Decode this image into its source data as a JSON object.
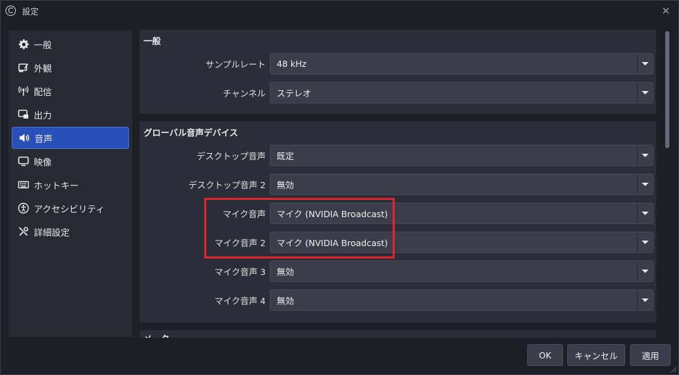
{
  "window": {
    "title": "設定"
  },
  "sidebar": {
    "items": [
      {
        "label": "一般",
        "icon": "gear-icon"
      },
      {
        "label": "外観",
        "icon": "paint-icon"
      },
      {
        "label": "配信",
        "icon": "antenna-icon"
      },
      {
        "label": "出力",
        "icon": "output-icon"
      },
      {
        "label": "音声",
        "icon": "speaker-icon",
        "active": true
      },
      {
        "label": "映像",
        "icon": "monitor-icon"
      },
      {
        "label": "ホットキー",
        "icon": "keyboard-icon"
      },
      {
        "label": "アクセシビリティ",
        "icon": "accessibility-icon"
      },
      {
        "label": "詳細設定",
        "icon": "tools-icon"
      }
    ]
  },
  "general": {
    "title": "一般",
    "sample_rate": {
      "label": "サンプルレート",
      "value": "48 kHz"
    },
    "channels": {
      "label": "チャンネル",
      "value": "ステレオ"
    }
  },
  "devices": {
    "title": "グローバル音声デバイス",
    "rows": [
      {
        "label": "デスクトップ音声",
        "value": "既定"
      },
      {
        "label": "デスクトップ音声 2",
        "value": "無効"
      },
      {
        "label": "マイク音声",
        "value": "マイク (NVIDIA Broadcast)"
      },
      {
        "label": "マイク音声 2",
        "value": "マイク (NVIDIA Broadcast)"
      },
      {
        "label": "マイク音声 3",
        "value": "無効"
      },
      {
        "label": "マイク音声 4",
        "value": "無効"
      }
    ]
  },
  "meters": {
    "title": "メーター"
  },
  "footer": {
    "ok": "OK",
    "cancel": "キャンセル",
    "apply": "適用"
  },
  "colors": {
    "accent": "#2a50b8",
    "highlight": "#e0262b"
  }
}
